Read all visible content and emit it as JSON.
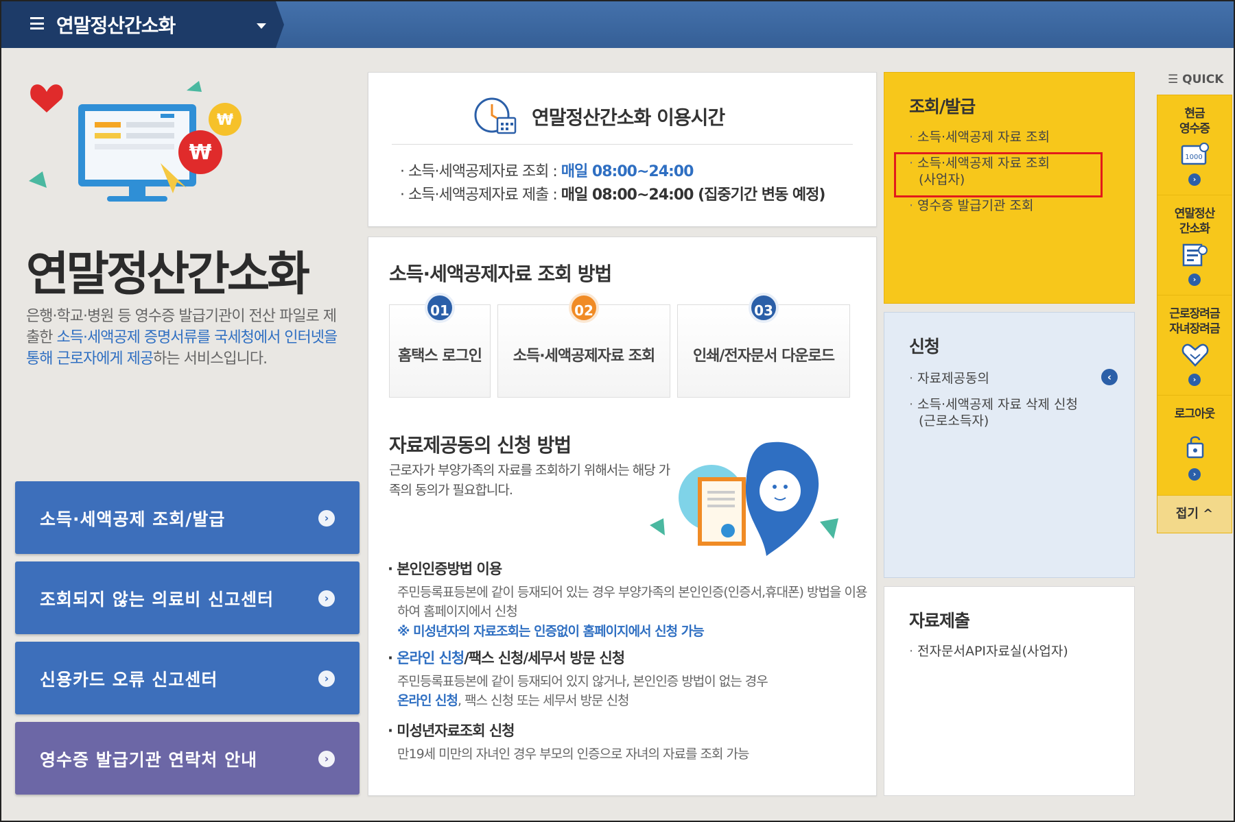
{
  "topbar": {
    "title": "연말정산간소화"
  },
  "hero": {
    "title": "연말정산간소화",
    "desc_1": "은행·학교·병원 등 영수증 발급기관이 전산 파일로 제출한 ",
    "desc_hl_1": "소득·세액공제 증명서류를 국세청에서 인터넷을 통해 근로자에게 제공",
    "desc_2": "하는 서비스입니다."
  },
  "left_buttons": [
    {
      "label": "소득·세액공제 조회/발급"
    },
    {
      "label": "조회되지 않는 의료비 신고센터"
    },
    {
      "label": "신용카드 오류 신고센터"
    },
    {
      "label": "영수증 발급기관 연락처 안내"
    }
  ],
  "hours": {
    "title": "연말정산간소화 이용시간",
    "row1_label": "· 소득·세액공제자료 조회 : ",
    "row1_time": "매일 08:00~24:00",
    "row2_label": "· 소득·세액공제자료 제출 : ",
    "row2_time": "매일 08:00~24:00 (집중기간 변동 예정)"
  },
  "method": {
    "title": "소득·세액공제자료 조회 방법",
    "steps": [
      {
        "num": "01",
        "label": "홈택스 로그인"
      },
      {
        "num": "02",
        "label": "소득·세액공제자료 조회"
      },
      {
        "num": "03",
        "label": "인쇄/전자문서 다운로드"
      }
    ],
    "consent_title": "자료제공동의 신청 방법",
    "consent_desc": "근로자가 부양가족의 자료를 조회하기 위해서는 해당 가족의 동의가 필요합니다.",
    "item1_title": "· 본인인증방법 이용",
    "item1_body": "주민등록표등본에 같이 등재되어 있는 경우 부양가족의 본인인증(인증서,휴대폰) 방법을 이용하여 홈페이지에서 신청",
    "item1_note": "※ 미성년자의 자료조회는 인증없이 홈페이지에서 신청 가능",
    "item2_title_hl": "온라인 신청",
    "item2_title_rest": "/팩스 신청/세무서 방문 신청",
    "item2_body": "주민등록표등본에 같이 등재되어 있지 않거나, 본인인증 방법이 없는 경우",
    "item2_body_hl": "온라인 신청",
    "item2_body_rest": ", 팩스 신청 또는 세무서 방문 신청",
    "item3_title": "· 미성년자료조회 신청",
    "item3_body": "만19세 미만의 자녀인 경우 부모의 인증으로 자녀의 자료를 조회 가능"
  },
  "panel_inquiry": {
    "title": "조회/발급",
    "links": [
      "소득·세액공제 자료 조회",
      "소득·세액공제 자료 조회",
      "(사업자)",
      "영수증 발급기관 조회"
    ]
  },
  "panel_apply": {
    "title": "신청",
    "links": [
      "자료제공동의",
      "소득·세액공제 자료 삭제 신청",
      "(근로소득자)"
    ]
  },
  "panel_submit": {
    "title": "자료제출",
    "links": [
      "전자문서API자료실(사업자)"
    ]
  },
  "quick": {
    "head": "QUICK",
    "items": [
      {
        "line1": "현금",
        "line2": "영수증",
        "icon": "receipt-icon",
        "icon_text": "1000"
      },
      {
        "line1": "연말정산",
        "line2": "간소화",
        "icon": "document-search-icon"
      },
      {
        "line1": "근로장려금",
        "line2": "자녀장려금",
        "icon": "heart-hand-icon"
      },
      {
        "line1": "로그아웃",
        "line2": "",
        "icon": "logout-lock-icon"
      }
    ],
    "fold": "접기 ^"
  },
  "colors": {
    "accent_blue": "#3d6fbb",
    "yellow": "#f7c71b",
    "purple": "#6c67a6",
    "highlight_red": "#e21b1b"
  }
}
